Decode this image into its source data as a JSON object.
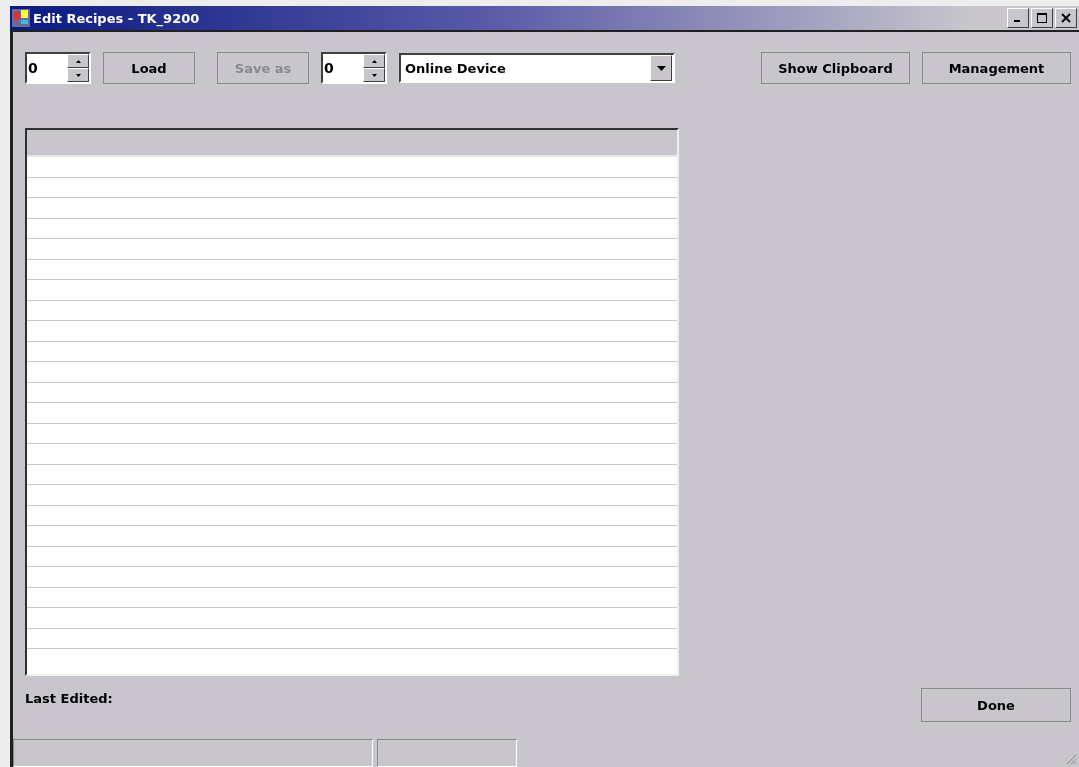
{
  "window": {
    "title": "Edit Recipes - TK_9200"
  },
  "toolbar": {
    "spinner_1": {
      "value": "0"
    },
    "load_button": {
      "label": "Load",
      "disabled": false
    },
    "save_as_button": {
      "label": "Save as",
      "disabled": true
    },
    "spinner_2": {
      "value": "0"
    },
    "device_dropdown": {
      "value": "Online Device"
    },
    "show_clipboard_button": {
      "label": "Show Clipboard",
      "disabled": false
    },
    "management_button": {
      "label": "Management",
      "disabled": false
    }
  },
  "last_edited": {
    "label": "Last Edited:"
  },
  "done_button": {
    "label": "Done",
    "disabled": false
  }
}
